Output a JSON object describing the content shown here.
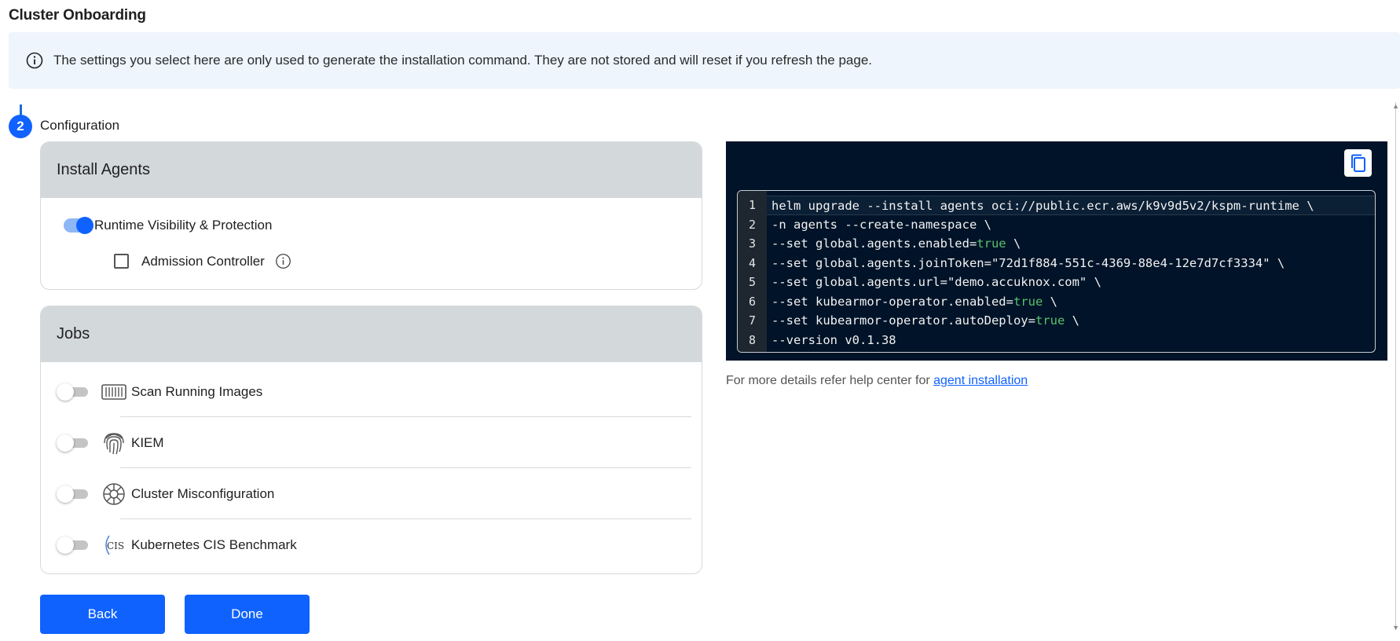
{
  "page": {
    "title": "Cluster Onboarding"
  },
  "banner": {
    "icon": "info-circle-icon",
    "text": "The settings you select here are only used to generate the installation command. They are not stored and will reset if you refresh the page."
  },
  "step": {
    "number": "2",
    "label": "Configuration"
  },
  "install_agents": {
    "title": "Install Agents",
    "runtime_label": "Runtime Visibility & Protection",
    "runtime_enabled": true,
    "admission_label": "Admission Controller",
    "admission_checked": false,
    "admission_info_icon": "info-circle-icon"
  },
  "jobs": {
    "title": "Jobs",
    "items": [
      {
        "label": "Scan Running Images",
        "icon": "container-icon",
        "enabled": false
      },
      {
        "label": "KIEM",
        "icon": "fingerprint-icon",
        "enabled": false
      },
      {
        "label": "Cluster Misconfiguration",
        "icon": "helm-wheel-icon",
        "enabled": false
      },
      {
        "label": "Kubernetes CIS Benchmark",
        "icon": "cis-logo-icon",
        "enabled": false
      }
    ]
  },
  "code": {
    "copy_icon": "copy-icon",
    "line_numbers": [
      "1",
      "2",
      "3",
      "4",
      "5",
      "6",
      "7",
      "8"
    ],
    "lines": [
      {
        "text": "helm upgrade --install agents oci://public.ecr.aws/k9v9d5v2/kspm-runtime \\",
        "pre": "",
        "kw": "",
        "post": ""
      },
      {
        "text": "-n agents --create-namespace \\",
        "pre": "",
        "kw": "",
        "post": ""
      },
      {
        "text": "",
        "pre": "--set global.agents.enabled=",
        "kw": "true",
        "post": " \\"
      },
      {
        "text": "--set global.agents.joinToken=\"72d1f884-551c-4369-88e4-12e7d7cf3334\" \\",
        "pre": "",
        "kw": "",
        "post": ""
      },
      {
        "text": "--set global.agents.url=\"demo.accuknox.com\" \\",
        "pre": "",
        "kw": "",
        "post": ""
      },
      {
        "text": "",
        "pre": "--set kubearmor-operator.enabled=",
        "kw": "true",
        "post": " \\"
      },
      {
        "text": "",
        "pre": "--set kubearmor-operator.autoDeploy=",
        "kw": "true",
        "post": " \\"
      },
      {
        "text": "--version v0.1.38",
        "pre": "",
        "kw": "",
        "post": ""
      }
    ]
  },
  "help": {
    "prefix": "For more details refer help center for ",
    "link_text": "agent installation"
  },
  "buttons": {
    "back": "Back",
    "done": "Done"
  },
  "colors": {
    "accent": "#0f62fe",
    "code_bg": "#001328",
    "keyword": "#58c16a",
    "banner_bg": "#eef5fd",
    "card_header": "#d3d8db"
  }
}
